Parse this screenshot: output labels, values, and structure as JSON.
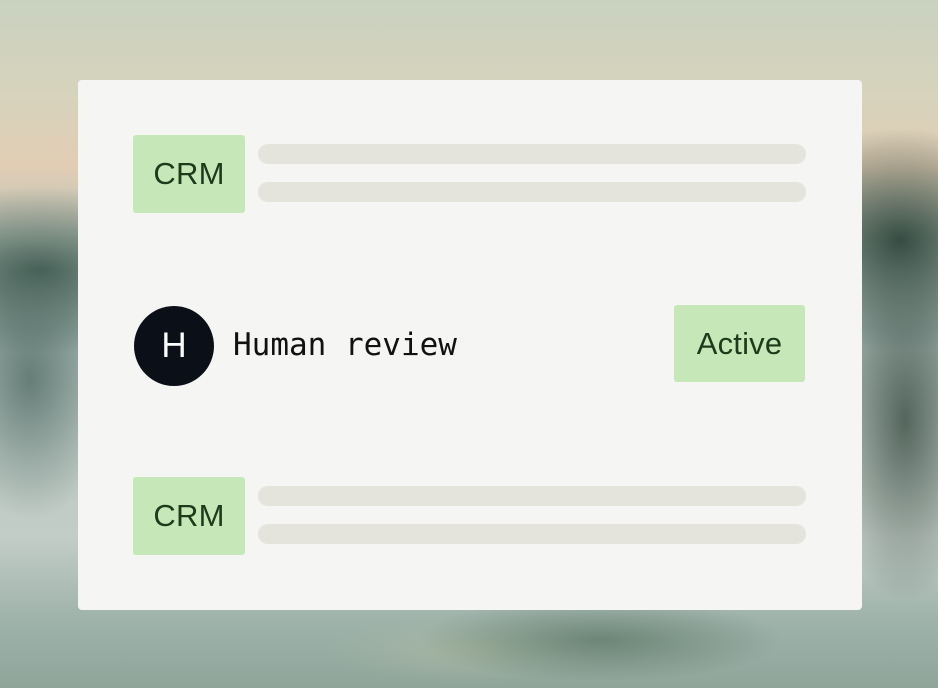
{
  "rows": [
    {
      "tag": "CRM"
    },
    {
      "avatar_initial": "H",
      "name": "Human review",
      "status": "Active"
    },
    {
      "tag": "CRM"
    }
  ],
  "colors": {
    "card_bg": "#f5f5f3",
    "tag_bg": "#c6e8b8",
    "tag_text": "#1d3a1a",
    "placeholder_line": "#e4e4dc",
    "avatar_bg": "#0b0f17"
  }
}
